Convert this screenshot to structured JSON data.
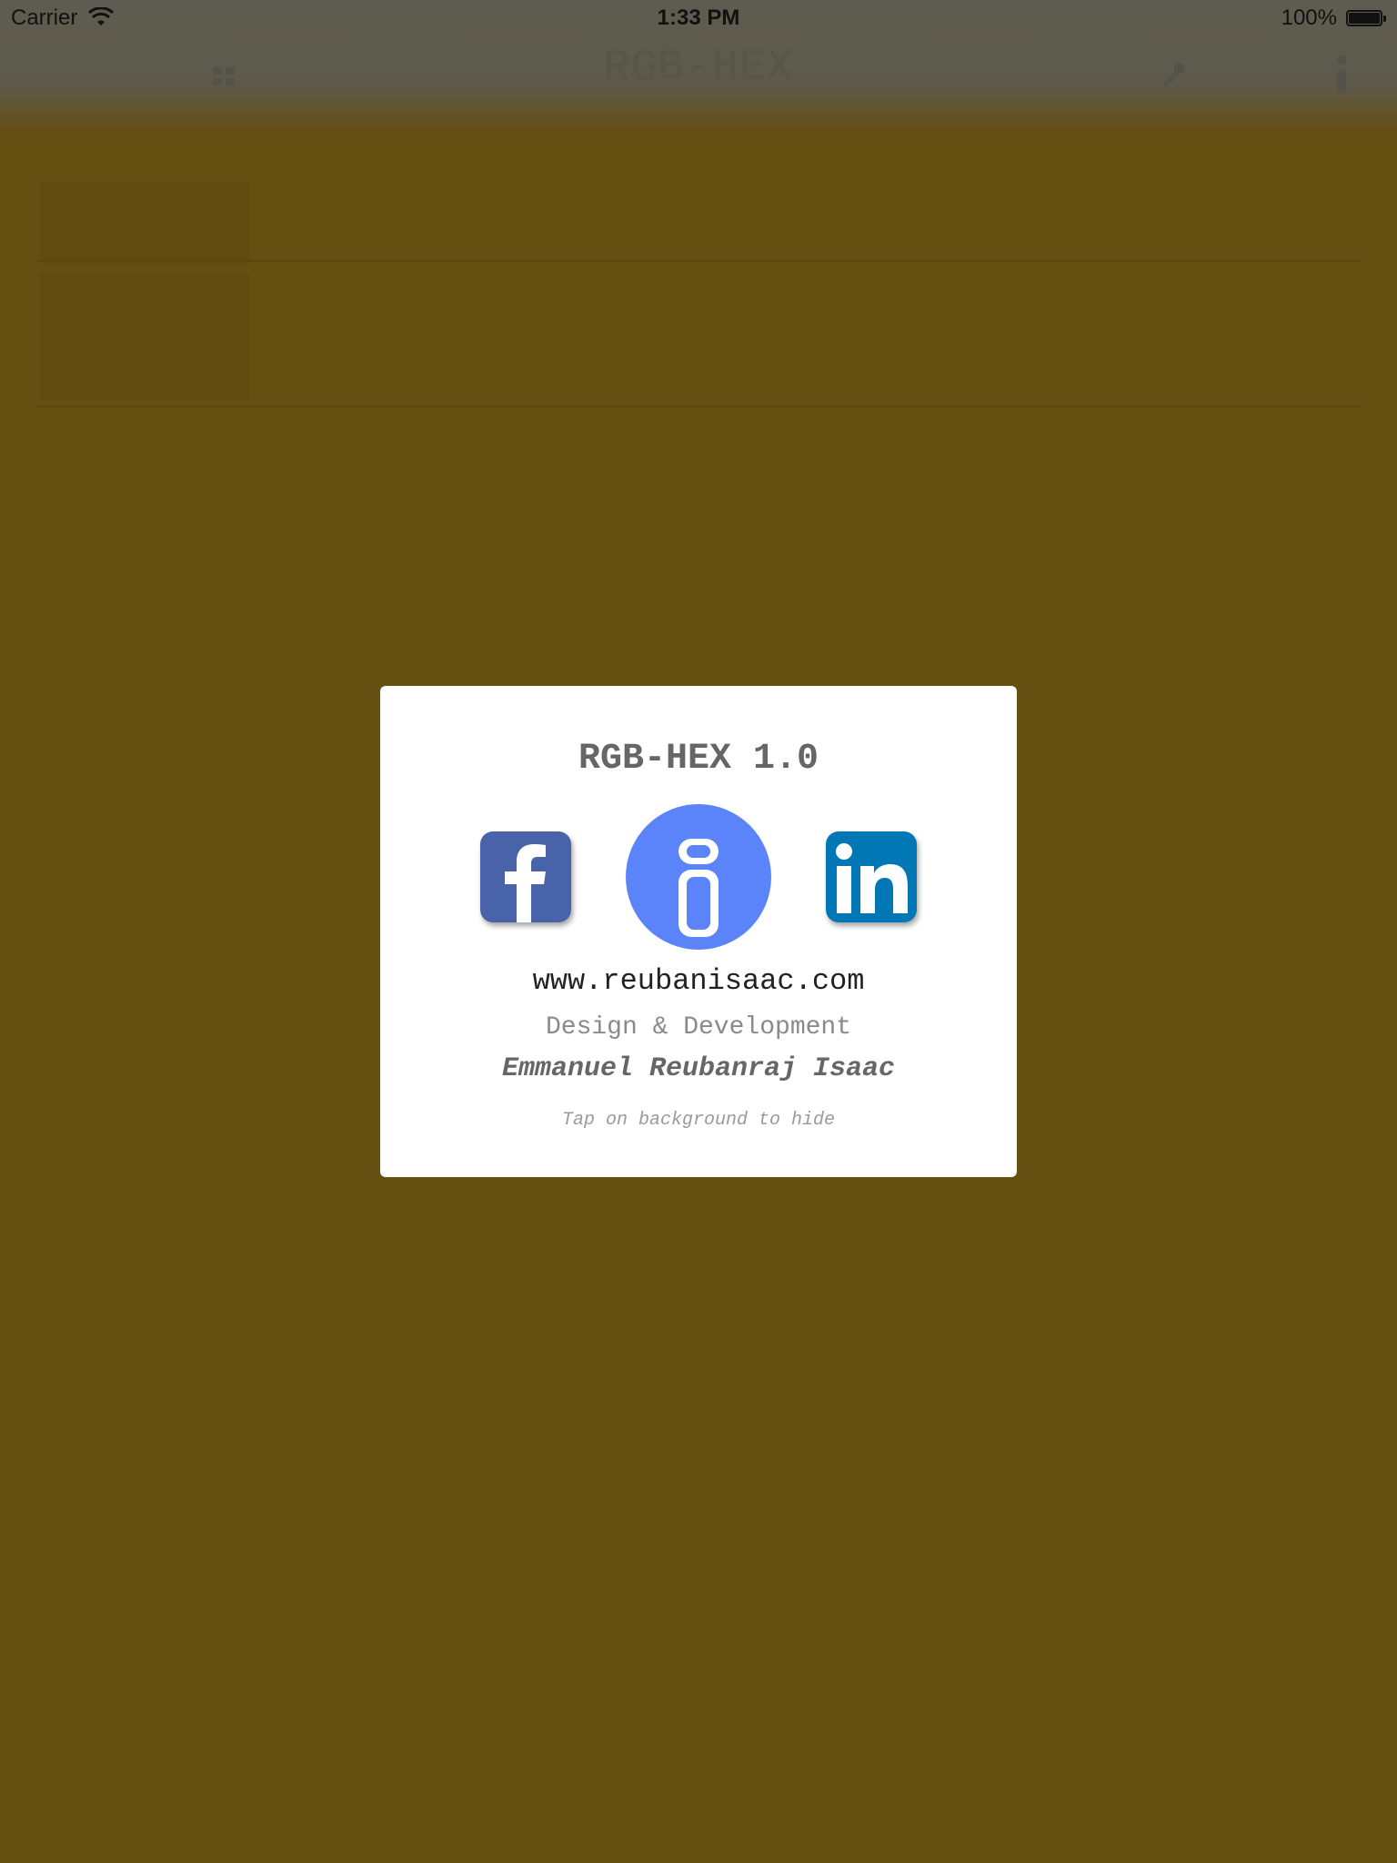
{
  "status_bar": {
    "carrier": "Carrier",
    "time": "1:33 PM",
    "battery": "100%"
  },
  "background": {
    "nav_title": "RGB-HEX",
    "nav_left_icon": "grid-icon",
    "nav_right_icons": [
      "dropper-icon",
      "info-icon"
    ],
    "color": "#654f11"
  },
  "about_card": {
    "title": "RGB-HEX 1.0",
    "icons": [
      "facebook-icon",
      "info-icon",
      "linkedin-icon"
    ],
    "url": "www.reubanisaac.com",
    "role": "Design & Development",
    "author": "Emmanuel Reubanraj Isaac",
    "hint": "Tap on background to hide",
    "colors": {
      "facebook": "#4863a9",
      "info": "#5b84fb",
      "linkedin": "#0177b5"
    }
  }
}
